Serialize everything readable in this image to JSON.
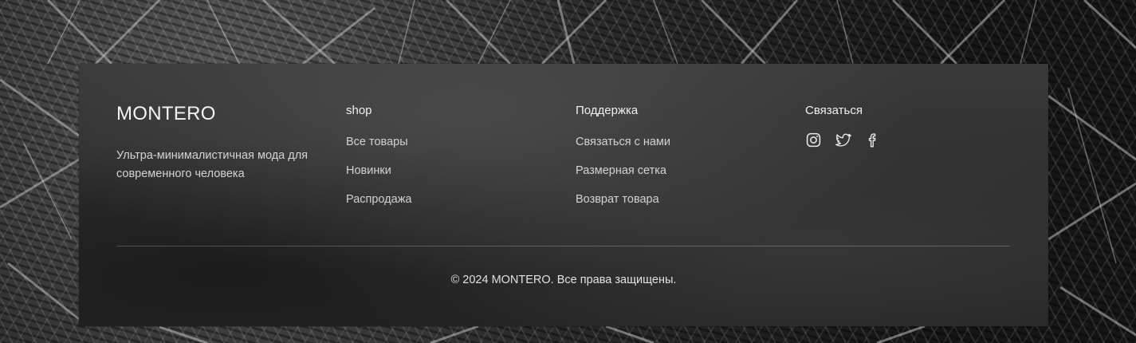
{
  "brand": {
    "name": "MONTERO",
    "tagline": "Ультра-минималистичная мода для современного человека"
  },
  "columns": [
    {
      "title": "shop",
      "links": [
        "Все товары",
        "Новинки",
        "Распродажа"
      ]
    },
    {
      "title": "Поддержка",
      "links": [
        "Связаться с нами",
        "Размерная сетка",
        "Возврат товара"
      ]
    },
    {
      "title": "Связаться",
      "socials": [
        "instagram-icon",
        "twitter-icon",
        "facebook-icon"
      ]
    }
  ],
  "copyright": "© 2024 MONTERO. Все права защищены.",
  "colors": {
    "footer_bg": "#2f2f2f",
    "text_primary": "#f4f4f4",
    "text_secondary": "#d2d2d2",
    "divider": "#5a5a5a"
  }
}
